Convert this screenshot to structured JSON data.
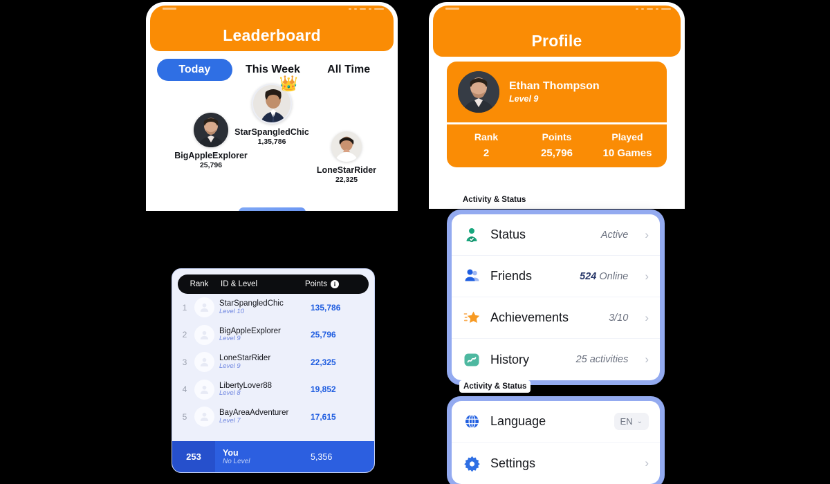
{
  "leaderboard": {
    "header_title": "Leaderboard",
    "tabs": [
      {
        "label": "Today",
        "active": true
      },
      {
        "label": "This Week",
        "active": false
      },
      {
        "label": "All Time",
        "active": false
      }
    ],
    "podium": {
      "first": {
        "place": "1",
        "name": "StarSpangledChic",
        "points": "1,35,786",
        "crown": "crown-icon"
      },
      "second": {
        "place": "2",
        "name": "BigAppleExplorer",
        "points": "25,796"
      },
      "third": {
        "place": "3",
        "name": "LoneStarRider",
        "points": "22,325"
      }
    },
    "table": {
      "columns": {
        "rank": "Rank",
        "id_level": "ID & Level",
        "points": "Points",
        "info": "i"
      },
      "rows": [
        {
          "rank": "1",
          "name": "StarSpangledChic",
          "level": "Level 10",
          "points": "135,786"
        },
        {
          "rank": "2",
          "name": "BigAppleExplorer",
          "level": "Level 9",
          "points": "25,796"
        },
        {
          "rank": "3",
          "name": "LoneStarRider",
          "level": "Level 9",
          "points": "22,325"
        },
        {
          "rank": "4",
          "name": "LibertyLover88",
          "level": "Level 8",
          "points": "19,852"
        },
        {
          "rank": "5",
          "name": "BayAreaAdventurer",
          "level": "Level 7",
          "points": "17,615"
        }
      ],
      "you": {
        "rank": "253",
        "name": "You",
        "level": "No Level",
        "points": "5,356"
      }
    }
  },
  "profile": {
    "header_title": "Profile",
    "user": {
      "name": "Ethan Thompson",
      "level": "Level 9"
    },
    "stats": [
      {
        "label": "Rank",
        "value": "2"
      },
      {
        "label": "Points",
        "value": "25,796"
      },
      {
        "label": "Played",
        "value": "10 Games"
      }
    ],
    "section_label_1": "Activity & Status",
    "section_label_2": "Activity & Status",
    "activity_rows": [
      {
        "icon": "person-check-icon",
        "label": "Status",
        "value": "Active",
        "value_strong": ""
      },
      {
        "icon": "people-icon",
        "label": "Friends",
        "value": " Online",
        "value_strong": "524"
      },
      {
        "icon": "star-icon",
        "label": "Achievements",
        "value": "3/10",
        "value_strong": ""
      },
      {
        "icon": "chart-wave-icon",
        "label": "History",
        "value": "25 activities",
        "value_strong": ""
      }
    ],
    "settings_rows": [
      {
        "icon": "globe-icon",
        "label": "Language",
        "value": "EN"
      },
      {
        "icon": "gear-icon",
        "label": "Settings",
        "value": ""
      }
    ]
  },
  "colors": {
    "brand_orange": "#FA8C05",
    "accent_blue": "#2F6FE4",
    "card_lavender": "#EDF0FB",
    "list_border_blue": "#93AAF0",
    "you_row_blue": "#2C5FE0"
  }
}
